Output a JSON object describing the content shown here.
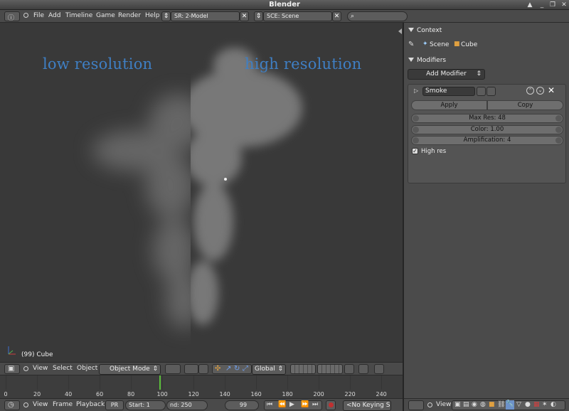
{
  "window": {
    "title": "Blender"
  },
  "info_header": {
    "menu": [
      "File",
      "Add",
      "Timeline",
      "Game",
      "Render",
      "Help"
    ],
    "screen_field": "SR: 2-Model",
    "scene_field": "SCE: Scene"
  },
  "viewport": {
    "label_left": "low resolution",
    "label_right": "high resolution",
    "object_name": "(99) Cube"
  },
  "viewport_header": {
    "menu": [
      "View",
      "Select",
      "Object"
    ],
    "mode": "Object Mode",
    "orientation": "Global"
  },
  "timeline": {
    "ticks": [
      "0",
      "20",
      "40",
      "60",
      "80",
      "100",
      "120",
      "140",
      "160",
      "180",
      "200",
      "220",
      "240"
    ],
    "current_frame_tick": "100"
  },
  "timeline_header": {
    "menu": [
      "View",
      "Frame",
      "Playback"
    ],
    "pr_label": "PR",
    "start": "Start: 1",
    "end": "nd: 250",
    "current": "99",
    "keying": "<No Keying S"
  },
  "properties": {
    "context_label": "Context",
    "context_scene": "Scene",
    "context_object": "Cube",
    "modifiers_label": "Modifiers",
    "add_modifier": "Add Modifier",
    "modifier_name": "Smoke",
    "apply": "Apply",
    "copy": "Copy",
    "max_res": "Max Res: 48",
    "color": "Color: 1.00",
    "amplification": "Amplification: 4",
    "high_res": "High res",
    "footer_view": "View"
  },
  "colors": {
    "accent_label": "#3f7fc4",
    "frame_cursor": "#5cbf3c"
  }
}
